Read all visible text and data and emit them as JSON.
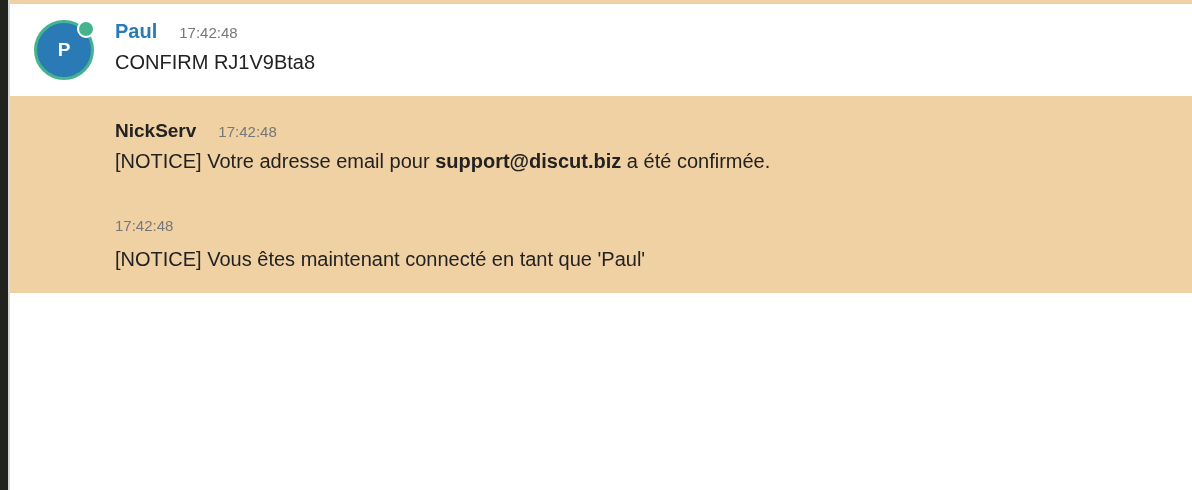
{
  "messages": [
    {
      "kind": "user",
      "highlighted": false,
      "author": "Paul",
      "avatar": {
        "initial": "P",
        "online": true
      },
      "entries": [
        {
          "time": "17:42:48",
          "text": "CONFIRM RJ1V9Bta8"
        }
      ]
    },
    {
      "kind": "service",
      "highlighted": true,
      "author": "NickServ",
      "entries": [
        {
          "time": "17:42:48",
          "text": "[NOTICE] Votre adresse email pour **support@discut.biz** a été confirmée."
        },
        {
          "time": "17:42:48",
          "text": "[NOTICE] Vous êtes maintenant connecté en tant que 'Paul'"
        }
      ]
    }
  ]
}
